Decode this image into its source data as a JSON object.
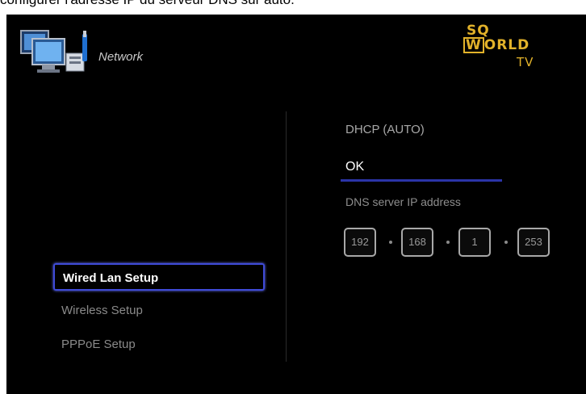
{
  "caption": "configurer l'adresse IP du serveur DNS sur auto.",
  "header": {
    "title": "Network",
    "icon": "network-settings-icon"
  },
  "logo": {
    "line1": "SQ",
    "line2_boxed": "W",
    "line2_rest": "ORLD",
    "line3": "TV"
  },
  "menu": {
    "items": [
      {
        "label": "Wired Lan Setup",
        "selected": true
      },
      {
        "label": "Wireless Setup",
        "selected": false
      },
      {
        "label": "PPPoE Setup",
        "selected": false
      }
    ]
  },
  "settings": {
    "dhcp_label": "DHCP (AUTO)",
    "ok_label": "OK",
    "dns_label": "DNS server IP address",
    "dns_octets": [
      "192",
      "168",
      "1",
      "253"
    ]
  },
  "colors": {
    "screen_background": "#000000",
    "selection_border": "#3f4bd8",
    "logo_gold": "#e2b22a"
  }
}
